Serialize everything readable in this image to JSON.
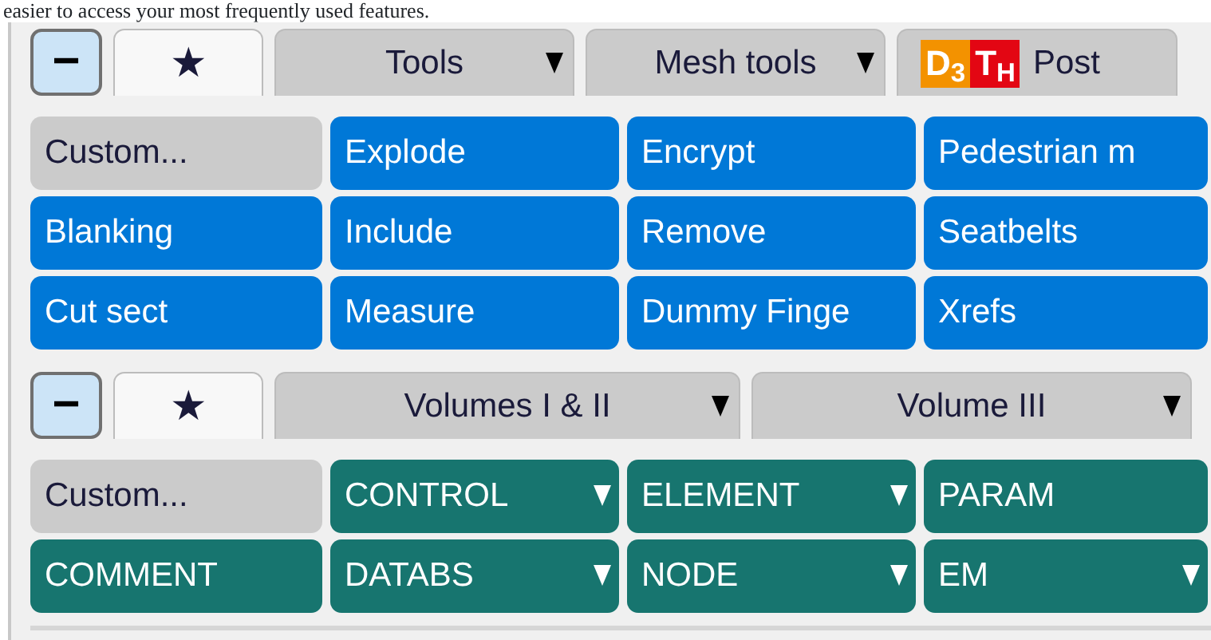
{
  "intro_text": "easier to access your most frequently used features.",
  "panels": [
    {
      "collapse_button": {
        "symbol": "−"
      },
      "color": "#0078d7",
      "tabs": [
        {
          "label": "★",
          "kind": "favourites",
          "selected": true
        },
        {
          "label": "Tools",
          "kind": "dropdown",
          "selected": false
        },
        {
          "label": "Mesh tools",
          "kind": "dropdown",
          "selected": false
        },
        {
          "label": "Post",
          "kind": "logo",
          "logo": [
            "D$_{3}$",
            "T$_{H}$"
          ],
          "selected": false
        }
      ],
      "buttons": [
        {
          "label": "Custom...",
          "kind": "custom"
        },
        {
          "label": "Explode",
          "kind": "action"
        },
        {
          "label": "Encrypt",
          "kind": "action"
        },
        {
          "label": "Pedestrian m",
          "kind": "action"
        },
        {
          "label": "Blanking",
          "kind": "action"
        },
        {
          "label": "Include",
          "kind": "action"
        },
        {
          "label": "Remove",
          "kind": "action"
        },
        {
          "label": "Seatbelts",
          "kind": "action"
        },
        {
          "label": "Cut sect",
          "kind": "action"
        },
        {
          "label": "Measure",
          "kind": "action"
        },
        {
          "label": "Dummy Finge",
          "kind": "action"
        },
        {
          "label": "Xrefs",
          "kind": "action"
        }
      ]
    },
    {
      "collapse_button": {
        "symbol": "−"
      },
      "color": "#17756f",
      "tabs": [
        {
          "label": "★",
          "kind": "favourites",
          "selected": true
        },
        {
          "label": "Volumes I & II",
          "kind": "dropdown",
          "selected": false
        },
        {
          "label": "Volume III",
          "kind": "dropdown",
          "selected": false
        }
      ],
      "buttons": [
        {
          "label": "Custom...",
          "kind": "custom"
        },
        {
          "label": "CONTROL",
          "kind": "menu"
        },
        {
          "label": "ELEMENT",
          "kind": "menu"
        },
        {
          "label": "PARAM",
          "kind": "action"
        },
        {
          "label": "COMMENT",
          "kind": "action"
        },
        {
          "label": "DATABS",
          "kind": "menu"
        },
        {
          "label": "NODE",
          "kind": "menu"
        },
        {
          "label": "EM",
          "kind": "menu"
        }
      ]
    }
  ]
}
